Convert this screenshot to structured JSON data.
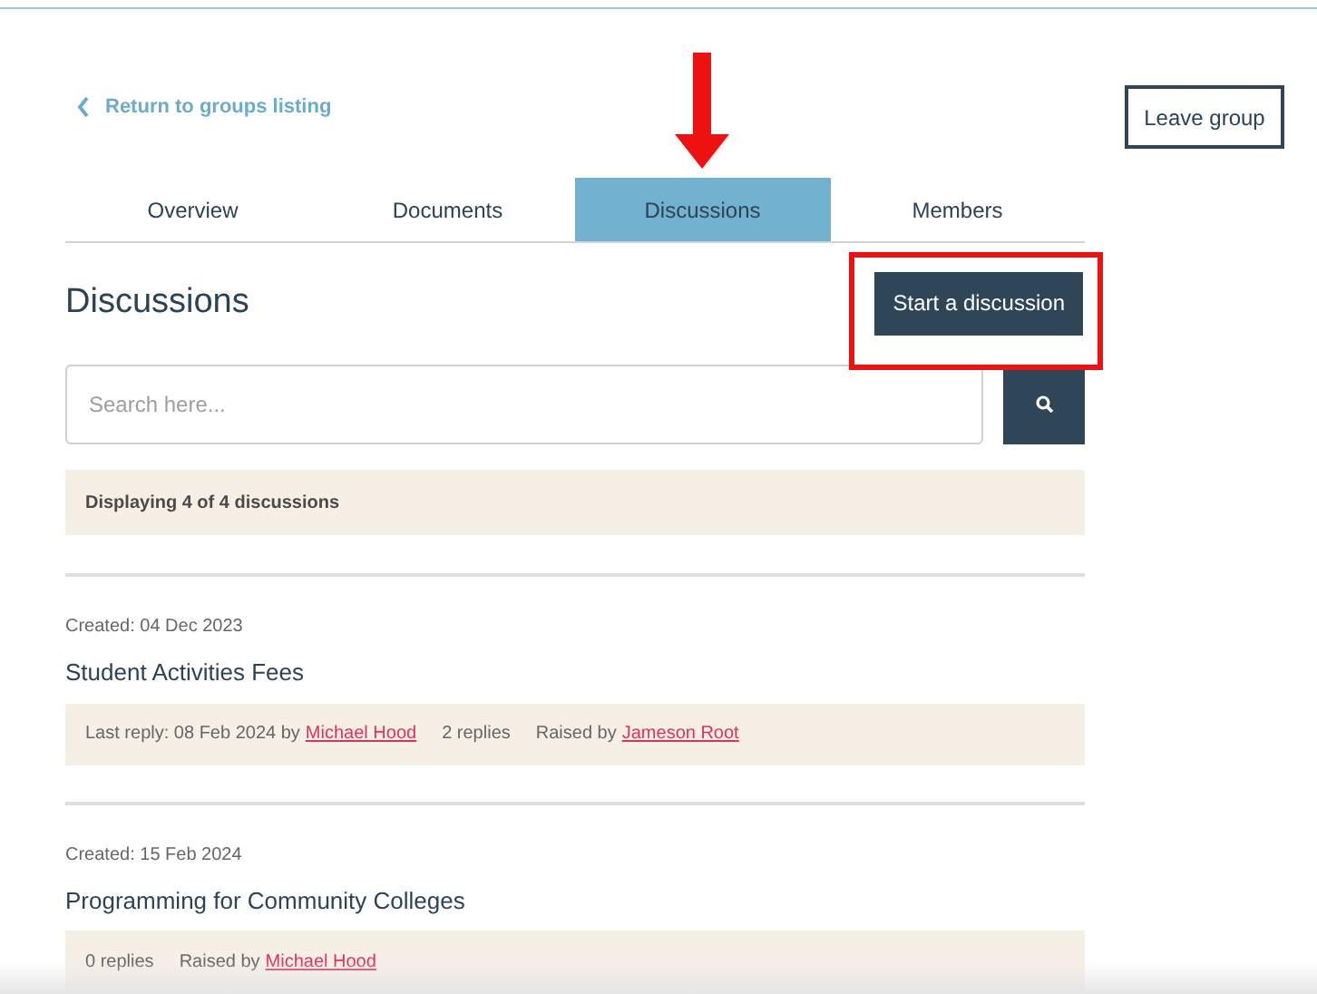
{
  "back_link": "Return to groups listing",
  "leave_button": "Leave group",
  "tabs": [
    {
      "label": "Overview",
      "selected": false,
      "pointed": false
    },
    {
      "label": "Documents",
      "selected": false,
      "pointed": false
    },
    {
      "label": "Discussions",
      "selected": true,
      "pointed": true
    },
    {
      "label": "Members",
      "selected": false,
      "pointed": false
    }
  ],
  "heading": "Discussions",
  "start_button": {
    "label": "Start a discussion",
    "highlighted": true
  },
  "search": {
    "placeholder": "Search here..."
  },
  "summary": "Displaying 4 of 4 discussions",
  "discussions": [
    {
      "created": "Created: 04 Dec 2023",
      "title": "Student Activities Fees",
      "meta": [
        {
          "text": "Last reply: 08 Feb 2024 by",
          "link": "Michael Hood"
        },
        {
          "text": "2 replies"
        },
        {
          "text": "Raised by",
          "link": "Jameson Root"
        }
      ]
    },
    {
      "created": "Created: 15 Feb 2024",
      "title": "Programming for Community Colleges",
      "meta": [
        {
          "text": "0 replies"
        },
        {
          "text": "Raised by",
          "link": "Michael Hood"
        }
      ]
    }
  ]
}
